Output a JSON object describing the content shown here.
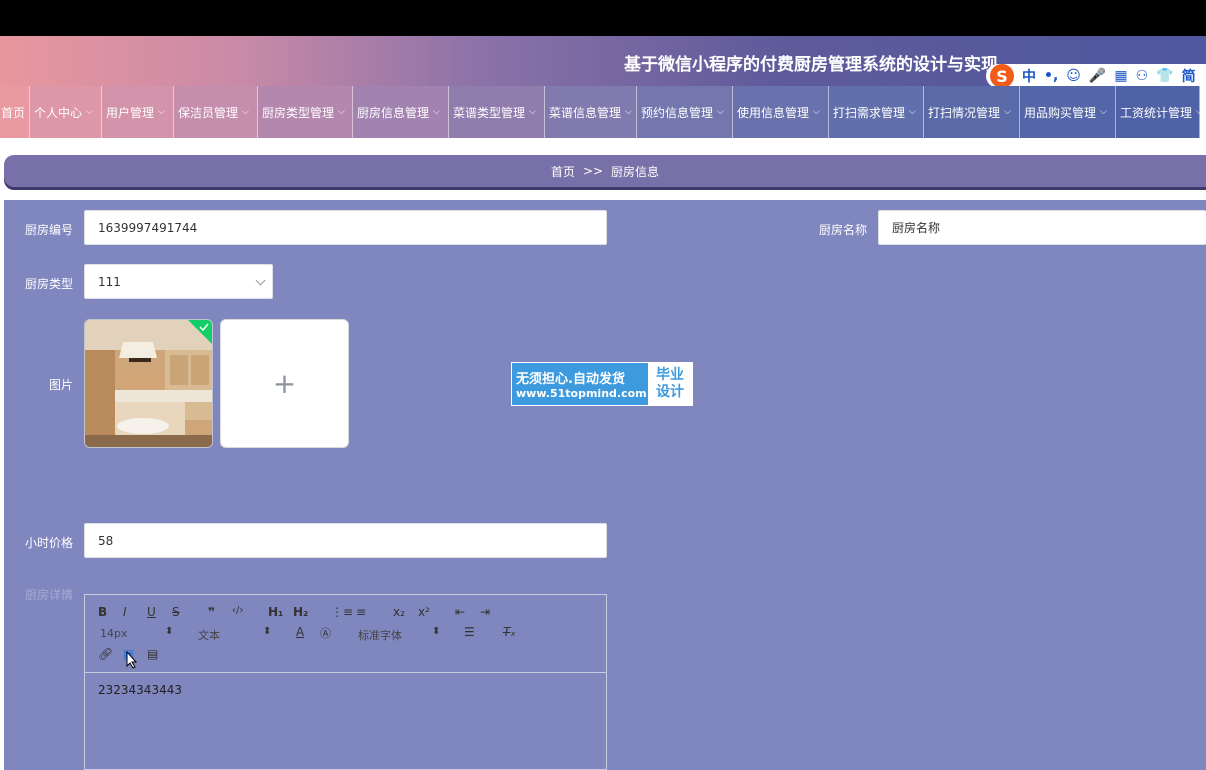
{
  "header": {
    "title": "基于微信小程序的付费厨房管理系统的设计与实现"
  },
  "ime": {
    "logo": "S",
    "items": [
      "中",
      "•,",
      "☺",
      "🎤",
      "▦",
      "⚇",
      "👕",
      "简"
    ]
  },
  "nav": {
    "items": [
      {
        "label": "首页",
        "chevron": false
      },
      {
        "label": "个人中心",
        "chevron": true
      },
      {
        "label": "用户管理",
        "chevron": true
      },
      {
        "label": "保洁员管理",
        "chevron": true
      },
      {
        "label": "厨房类型管理",
        "chevron": true
      },
      {
        "label": "厨房信息管理",
        "chevron": true
      },
      {
        "label": "菜谱类型管理",
        "chevron": true
      },
      {
        "label": "菜谱信息管理",
        "chevron": true
      },
      {
        "label": "预约信息管理",
        "chevron": true
      },
      {
        "label": "使用信息管理",
        "chevron": true
      },
      {
        "label": "打扫需求管理",
        "chevron": true
      },
      {
        "label": "打扫情况管理",
        "chevron": true
      },
      {
        "label": "用品购买管理",
        "chevron": true
      },
      {
        "label": "工资统计管理",
        "chevron": true
      }
    ],
    "chevron_glyph": "⌵"
  },
  "breadcrumb": {
    "home": "首页",
    "separator": ">>",
    "current": "厨房信息"
  },
  "form": {
    "kitchen_no": {
      "label": "厨房编号",
      "value": "1639997491744"
    },
    "kitchen_name": {
      "label": "厨房名称",
      "value": "厨房名称"
    },
    "kitchen_type": {
      "label": "厨房类型",
      "value": "111"
    },
    "image": {
      "label": "图片",
      "plus": "+"
    },
    "hourly_price": {
      "label": "小时价格",
      "value": "58"
    },
    "details": {
      "label": "厨房详情"
    }
  },
  "editor": {
    "toolbar_row1": [
      "B",
      "I",
      "U",
      "S",
      "❞",
      "‹/›",
      "H₁",
      "H₂",
      "⋮≡",
      "≡",
      "x₂",
      "x²",
      "⇤",
      "⇥"
    ],
    "font_size": "14px",
    "header_select": "文本",
    "font_family": "标准字体",
    "content": "23234343443"
  },
  "watermark": {
    "line1": "无须担心.自动发货",
    "line2": "www.51topmind.com",
    "badge1": "毕业",
    "badge2": "设计"
  },
  "colors": {
    "main_bg": "#8086be",
    "breadcrumb_bg": "#7870a8",
    "header_start": "#e8979e",
    "header_end": "#4f58a0"
  }
}
